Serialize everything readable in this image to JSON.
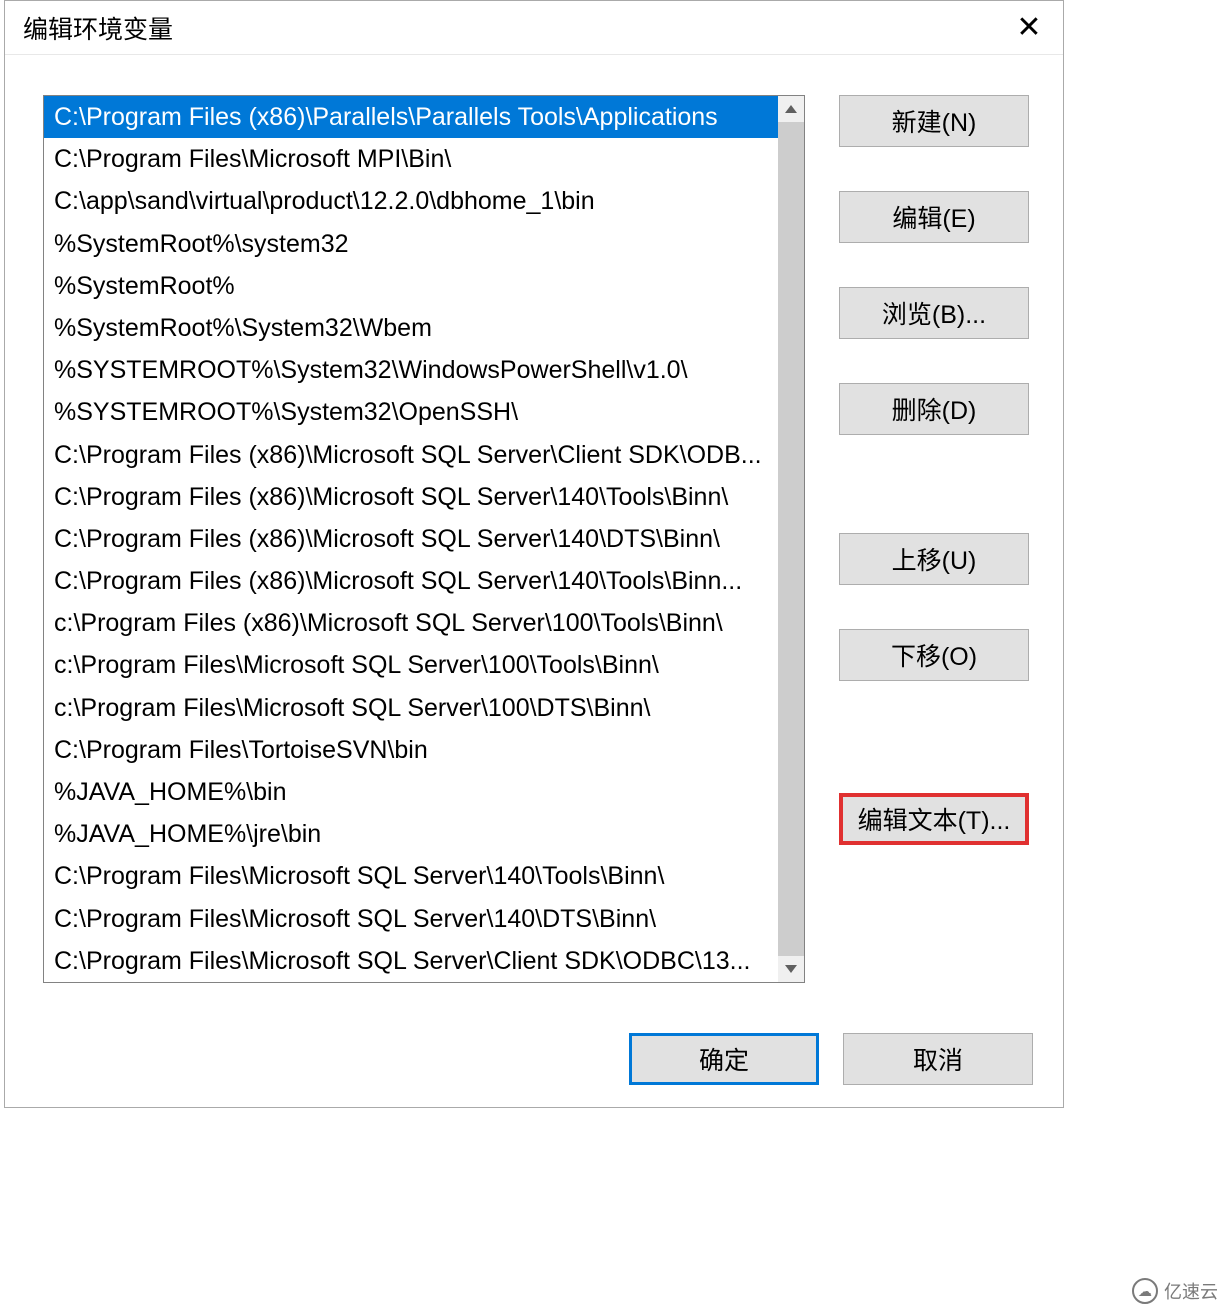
{
  "window": {
    "title": "编辑环境变量",
    "close_label": "✕"
  },
  "paths": [
    "C:\\Program Files (x86)\\Parallels\\Parallels Tools\\Applications",
    "C:\\Program Files\\Microsoft MPI\\Bin\\",
    "C:\\app\\sand\\virtual\\product\\12.2.0\\dbhome_1\\bin",
    "%SystemRoot%\\system32",
    "%SystemRoot%",
    "%SystemRoot%\\System32\\Wbem",
    "%SYSTEMROOT%\\System32\\WindowsPowerShell\\v1.0\\",
    "%SYSTEMROOT%\\System32\\OpenSSH\\",
    "C:\\Program Files (x86)\\Microsoft SQL Server\\Client SDK\\ODB...",
    "C:\\Program Files (x86)\\Microsoft SQL Server\\140\\Tools\\Binn\\",
    "C:\\Program Files (x86)\\Microsoft SQL Server\\140\\DTS\\Binn\\",
    "C:\\Program Files (x86)\\Microsoft SQL Server\\140\\Tools\\Binn...",
    "c:\\Program Files (x86)\\Microsoft SQL Server\\100\\Tools\\Binn\\",
    "c:\\Program Files\\Microsoft SQL Server\\100\\Tools\\Binn\\",
    "c:\\Program Files\\Microsoft SQL Server\\100\\DTS\\Binn\\",
    "C:\\Program Files\\TortoiseSVN\\bin",
    "%JAVA_HOME%\\bin",
    "%JAVA_HOME%\\jre\\bin",
    "C:\\Program Files\\Microsoft SQL Server\\140\\Tools\\Binn\\",
    "C:\\Program Files\\Microsoft SQL Server\\140\\DTS\\Binn\\",
    "C:\\Program Files\\Microsoft SQL Server\\Client SDK\\ODBC\\13..."
  ],
  "selected_index": 0,
  "buttons": {
    "new": "新建(N)",
    "edit": "编辑(E)",
    "browse": "浏览(B)...",
    "delete": "删除(D)",
    "move_up": "上移(U)",
    "move_down": "下移(O)",
    "edit_text": "编辑文本(T)..."
  },
  "footer": {
    "ok": "确定",
    "cancel": "取消"
  },
  "watermark": "亿速云"
}
